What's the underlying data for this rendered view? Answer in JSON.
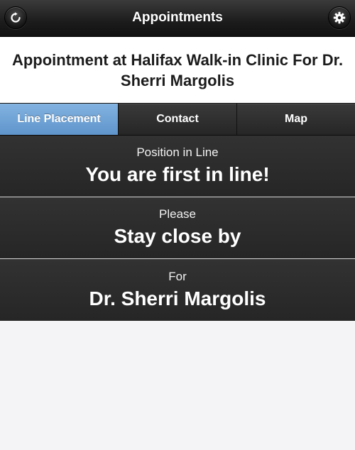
{
  "nav": {
    "title": "Appointments",
    "left_icon": "refresh-icon",
    "right_icon": "gear-icon"
  },
  "header": {
    "title": "Appointment at Halifax Walk-in Clinic For Dr. Sherri Margolis"
  },
  "tabs": [
    {
      "label": "Line Placement",
      "active": true
    },
    {
      "label": "Contact",
      "active": false
    },
    {
      "label": "Map",
      "active": false
    }
  ],
  "info": [
    {
      "label": "Position in Line",
      "value": "You are first in line!"
    },
    {
      "label": "Please",
      "value": "Stay close by"
    },
    {
      "label": "For",
      "value": "Dr. Sherri Margolis"
    }
  ],
  "colors": {
    "nav_background": "#1c1c1c",
    "active_tab": "#6fa3d6",
    "panel_background": "#2c2c2c",
    "page_background": "#f4f4f6"
  }
}
